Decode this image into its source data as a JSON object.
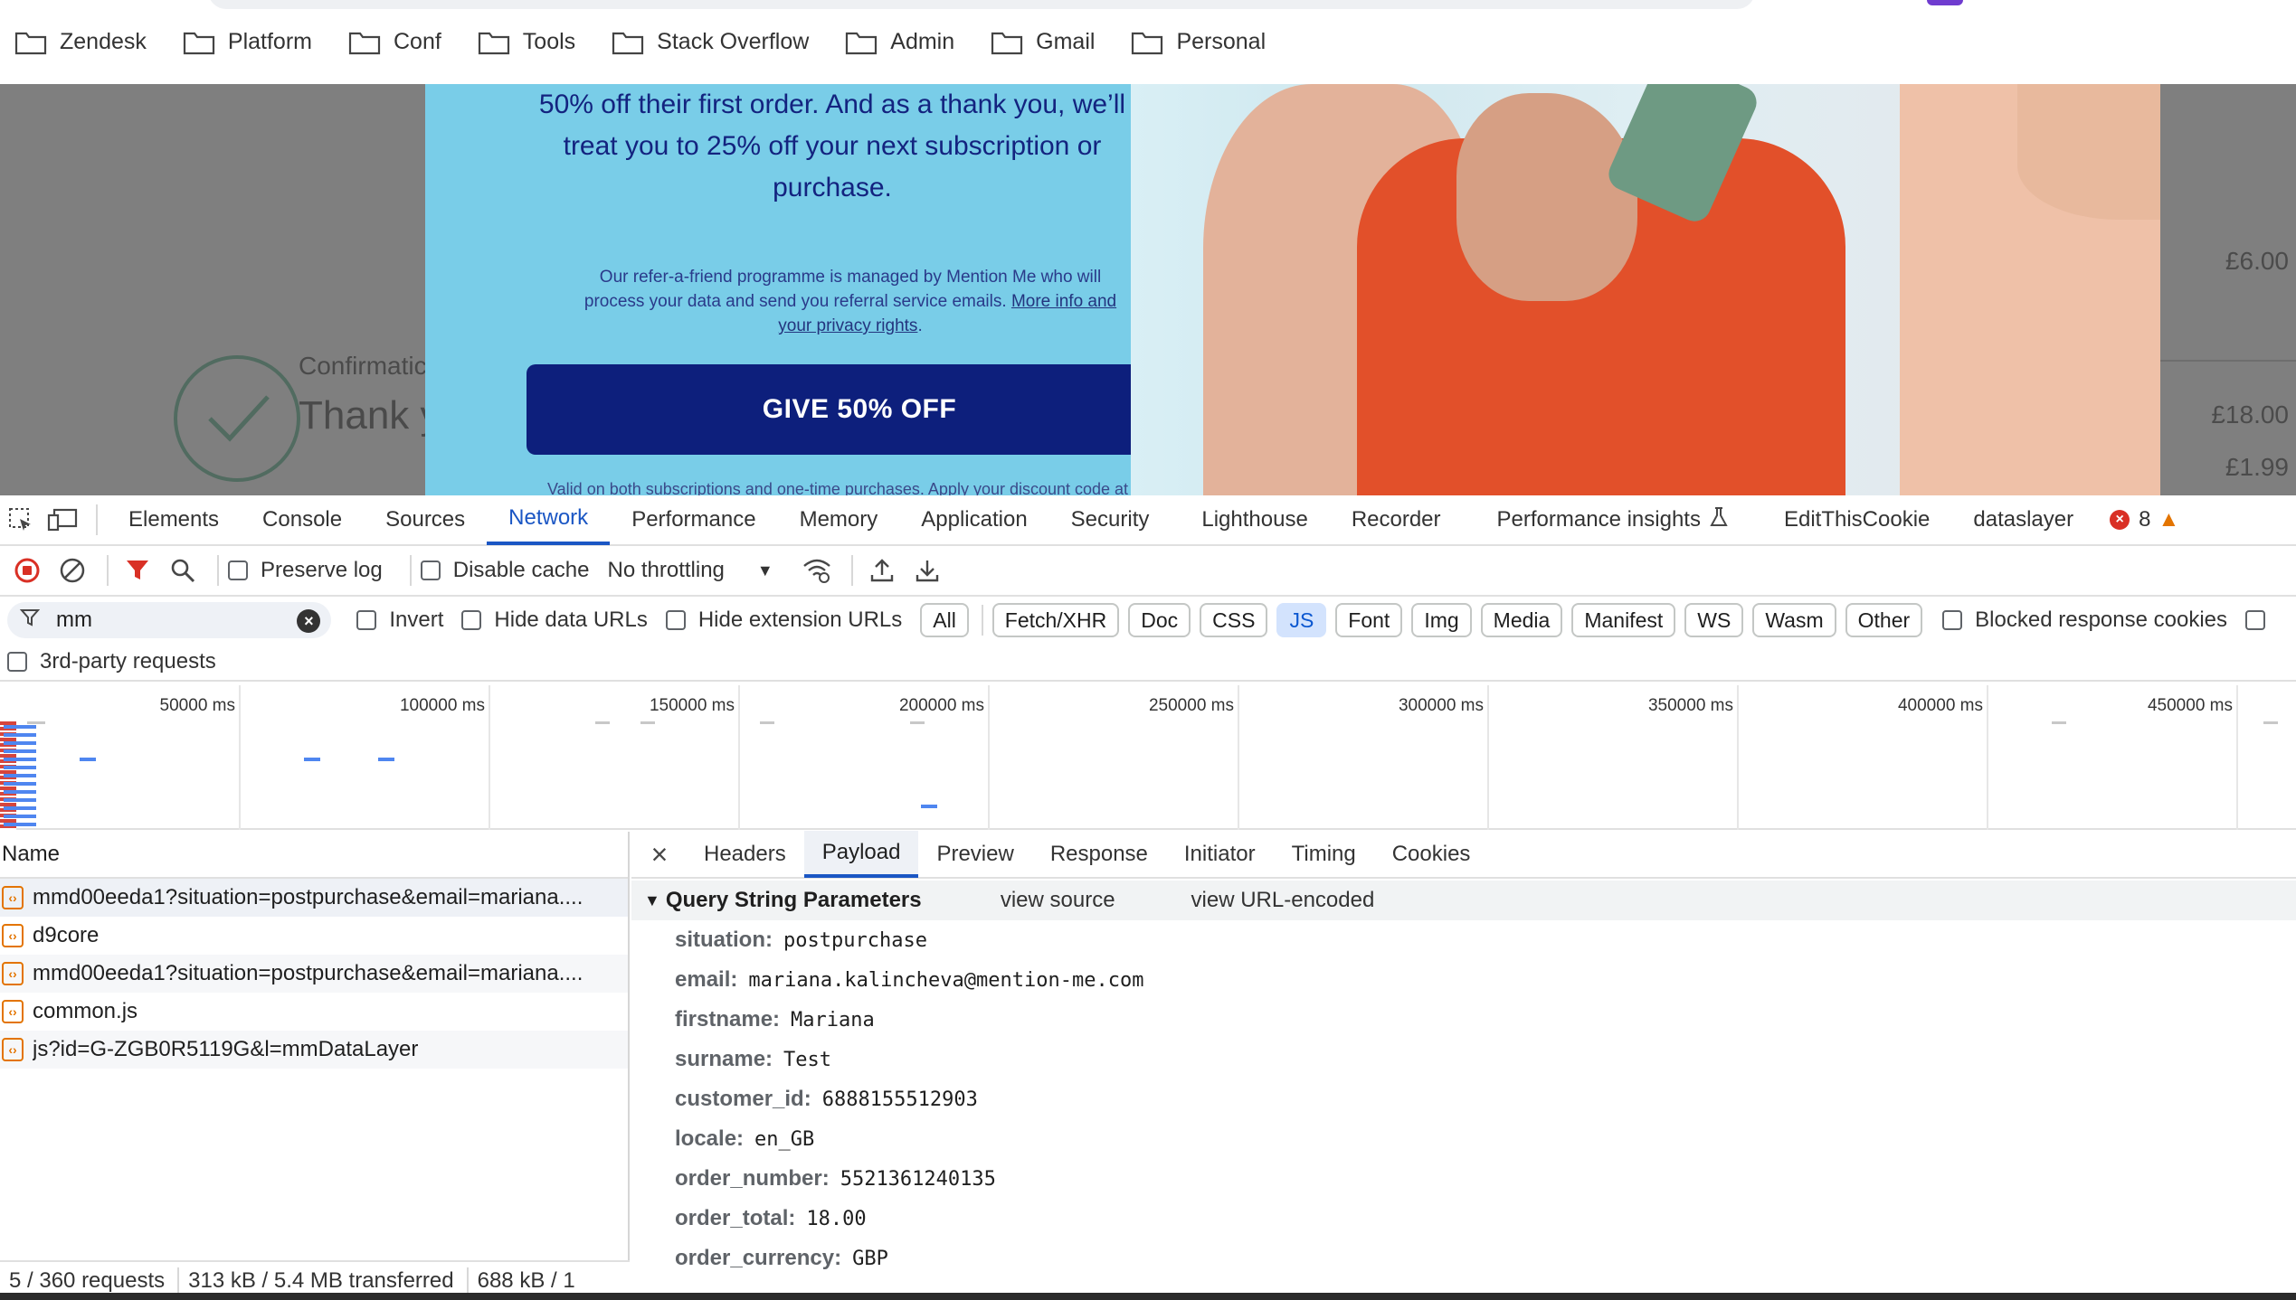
{
  "bookmarks": [
    {
      "label": "Zendesk",
      "icon": "folder-icon"
    },
    {
      "label": "Platform",
      "icon": "folder-icon"
    },
    {
      "label": "Conf",
      "icon": "folder-icon"
    },
    {
      "label": "Tools",
      "icon": "folder-icon"
    },
    {
      "label": "Stack Overflow",
      "icon": "folder-icon"
    },
    {
      "label": "Admin",
      "icon": "folder-icon"
    },
    {
      "label": "Gmail",
      "icon": "folder-icon"
    },
    {
      "label": "Personal",
      "icon": "folder-icon"
    }
  ],
  "page": {
    "confirmation_label": "Confirmatic",
    "thank_you": "Thank y",
    "prices": [
      "£6.00",
      "£18.00",
      "£1.99"
    ],
    "promo_text": "50% off their first order. And as a thank you, we’ll treat you to 25% off your next subscription or purchase.",
    "promo_small": "Our refer-a-friend programme is managed by Mention Me who will process your data and send you referral service emails.",
    "promo_link": "More info and your privacy rights",
    "promo_link_suffix": ".",
    "give_button": "GIVE 50% OFF",
    "valid_text": "Valid on both subscriptions and one-time purchases. Apply your discount code at",
    "colors": {
      "modal_bg": "#79cde8",
      "button_bg": "#0d1f7c",
      "promo_text": "#13237f"
    }
  },
  "devtools": {
    "tabs": [
      "Elements",
      "Console",
      "Sources",
      "Network",
      "Performance",
      "Memory",
      "Application",
      "Security",
      "Lighthouse",
      "Recorder",
      "Performance insights",
      "EditThisCookie",
      "dataslayer"
    ],
    "active_tab": "Network",
    "error_count": "8",
    "toolbar": {
      "preserve_log": "Preserve log",
      "disable_cache": "Disable cache",
      "throttling": "No throttling"
    },
    "filter": {
      "value": "mm",
      "invert": "Invert",
      "hide_data_urls": "Hide data URLs",
      "hide_extension_urls": "Hide extension URLs",
      "types": [
        "All",
        "Fetch/XHR",
        "Doc",
        "CSS",
        "JS",
        "Font",
        "Img",
        "Media",
        "Manifest",
        "WS",
        "Wasm",
        "Other"
      ],
      "active_type": "JS",
      "blocked_cookies": "Blocked response cookies",
      "third_party": "3rd-party requests"
    },
    "overview_ticks": [
      "50000 ms",
      "100000 ms",
      "150000 ms",
      "200000 ms",
      "250000 ms",
      "300000 ms",
      "350000 ms",
      "400000 ms",
      "450000 ms"
    ],
    "requests": {
      "header": "Name",
      "rows": [
        "mmd00eeda1?situation=postpurchase&email=mariana....",
        "d9core",
        "mmd00eeda1?situation=postpurchase&email=mariana....",
        "common.js",
        "js?id=G-ZGB0R5119G&l=mmDataLayer"
      ],
      "status": {
        "count": "5 / 360 requests",
        "transferred": "313 kB / 5.4 MB transferred",
        "resources": "688 kB / 1"
      }
    },
    "detail": {
      "tabs": [
        "Headers",
        "Payload",
        "Preview",
        "Response",
        "Initiator",
        "Timing",
        "Cookies"
      ],
      "active_tab": "Payload",
      "section_title": "Query String Parameters",
      "view_source": "view source",
      "view_url_encoded": "view URL-encoded",
      "params": [
        {
          "key": "situation:",
          "value": "postpurchase"
        },
        {
          "key": "email:",
          "value": "mariana.kalincheva@mention-me.com"
        },
        {
          "key": "firstname:",
          "value": "Mariana"
        },
        {
          "key": "surname:",
          "value": "Test"
        },
        {
          "key": "customer_id:",
          "value": "6888155512903"
        },
        {
          "key": "locale:",
          "value": "en_GB"
        },
        {
          "key": "order_number:",
          "value": "5521361240135"
        },
        {
          "key": "order_total:",
          "value": "18.00"
        },
        {
          "key": "order_currency:",
          "value": "GBP"
        }
      ]
    }
  }
}
